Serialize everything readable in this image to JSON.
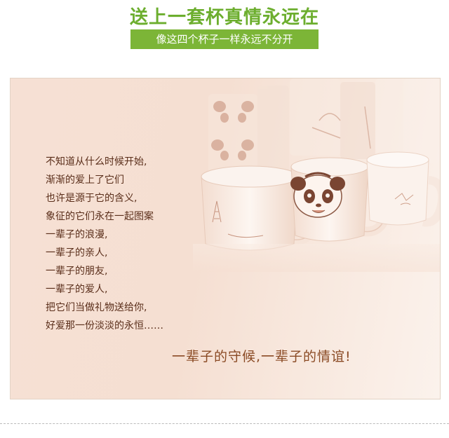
{
  "header": {
    "title": "送上一套杯真情永远在",
    "subtitle": "像这四个杯子一样永远不分开"
  },
  "poem": {
    "lines": [
      "不知道从什么时候开始,",
      "渐渐的爱上了它们",
      "也许是源于它的含义,",
      "象征的它们永在一起图案",
      "一辈子的浪漫,",
      "一辈子的亲人,",
      "一辈子的朋友,",
      "一辈子的爱人,",
      "把它们当做礼物送给你,",
      "好爱那一份淡淡的永恒……"
    ]
  },
  "tagline": "一辈子的守候,一辈子的情谊!",
  "colors": {
    "title_green": "#6cae2e",
    "subtitle_bar_green": "#7cb537",
    "poem_text": "#5a2e1a",
    "tagline_text": "#8a4a24",
    "photo_tint": "#f5dfd2"
  },
  "image": {
    "subject": "four white panda mugs on a warm peach-toned background"
  }
}
